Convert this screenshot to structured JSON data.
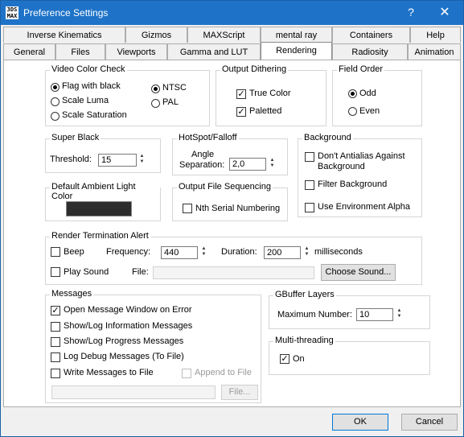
{
  "window": {
    "title": "Preference Settings",
    "help_label": "?",
    "close_label": "✕",
    "app_icon_text": "3DS MAX"
  },
  "tabs_row1": [
    "Inverse Kinematics",
    "Gizmos",
    "MAXScript",
    "mental ray",
    "Containers",
    "Help"
  ],
  "tabs_row2": [
    "General",
    "Files",
    "Viewports",
    "Gamma and LUT",
    "Rendering",
    "Radiosity",
    "Animation"
  ],
  "active_tab": "Rendering",
  "video_color_check": {
    "title": "Video Color Check",
    "options": [
      "Flag with black",
      "Scale Luma",
      "Scale Saturation"
    ],
    "selected": "Flag with black",
    "standards": [
      "NTSC",
      "PAL"
    ],
    "selected_standard": "NTSC"
  },
  "output_dithering": {
    "title": "Output Dithering",
    "true_color": "True Color",
    "true_color_checked": true,
    "paletted": "Paletted",
    "paletted_checked": true
  },
  "field_order": {
    "title": "Field Order",
    "odd": "Odd",
    "even": "Even",
    "selected": "Odd"
  },
  "super_black": {
    "title": "Super Black",
    "threshold_label": "Threshold:",
    "threshold_value": "15"
  },
  "hotspot_falloff": {
    "title": "HotSpot/Falloff",
    "angle_label_1": "Angle",
    "angle_label_2": "Separation:",
    "angle_value": "2,0"
  },
  "background": {
    "title": "Background",
    "dont_antialias_1": "Don't Antialias Against",
    "dont_antialias_2": "Background",
    "filter_background": "Filter Background",
    "use_env_alpha": "Use Environment Alpha"
  },
  "ambient_light": {
    "title": "Default Ambient Light Color",
    "color": "#2d2d2d"
  },
  "output_file_sequencing": {
    "title": "Output File Sequencing",
    "nth_serial": "Nth Serial Numbering"
  },
  "render_termination": {
    "title": "Render Termination Alert",
    "beep": "Beep",
    "frequency_label": "Frequency:",
    "frequency_value": "440",
    "duration_label": "Duration:",
    "duration_value": "200",
    "milliseconds": "milliseconds",
    "play_sound": "Play Sound",
    "file_label": "File:",
    "file_value": "",
    "choose_sound": "Choose Sound..."
  },
  "messages": {
    "title": "Messages",
    "items": [
      {
        "label": "Open Message Window on Error",
        "checked": true
      },
      {
        "label": "Show/Log Information Messages",
        "checked": false
      },
      {
        "label": "Show/Log Progress Messages",
        "checked": false
      },
      {
        "label": "Log Debug Messages (To File)",
        "checked": false
      },
      {
        "label": "Write Messages to File",
        "checked": false
      }
    ],
    "append_to_file": "Append to File",
    "file_button": "File...",
    "file_value": ""
  },
  "gbuffer": {
    "title": "GBuffer Layers",
    "max_label": "Maximum Number:",
    "max_value": "10"
  },
  "multithreading": {
    "title": "Multi-threading",
    "on_label": "On",
    "on_checked": true
  },
  "buttons": {
    "ok": "OK",
    "cancel": "Cancel"
  }
}
